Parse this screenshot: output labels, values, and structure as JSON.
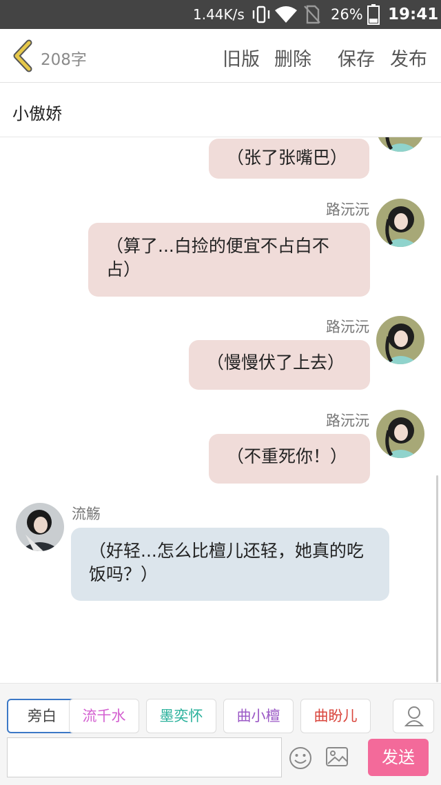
{
  "status_bar": {
    "net_speed": "1.44K/s",
    "battery_pct": "26%",
    "time": "19:41",
    "icons": [
      "vibrate-icon",
      "wifi-icon",
      "no-sim-icon",
      "battery-icon"
    ]
  },
  "toolbar": {
    "back_icon": "chevron-left-icon",
    "word_count": "208字",
    "old_version": "旧版",
    "delete": "删除",
    "save": "保存",
    "publish": "发布"
  },
  "title": "小傲娇",
  "messages": [
    {
      "side": "right",
      "sender": "",
      "text": "（张了张嘴巴）"
    },
    {
      "side": "right",
      "sender": "路沅沅",
      "text": "（算了...白捡的便宜不占白不占）"
    },
    {
      "side": "right",
      "sender": "路沅沅",
      "text": "（慢慢伏了上去）"
    },
    {
      "side": "right",
      "sender": "路沅沅",
      "text": "（不重死你！）"
    },
    {
      "side": "left",
      "sender": "流觞",
      "text": "（好轻...怎么比檀儿还轻，她真的吃饭吗？）"
    }
  ],
  "roles": [
    {
      "label": "旁白",
      "color": "#444444",
      "active": true
    },
    {
      "label": "流千水",
      "color": "#d35fd0",
      "active": false
    },
    {
      "label": "墨奕怀",
      "color": "#27b09a",
      "active": false
    },
    {
      "label": "曲小檀",
      "color": "#9b59c6",
      "active": false
    },
    {
      "label": "曲盼儿",
      "color": "#d9443b",
      "active": false
    }
  ],
  "composer": {
    "placeholder": "",
    "send": "发送",
    "icons": [
      "emoji-icon",
      "image-icon",
      "person-icon"
    ]
  },
  "colors": {
    "status_bar_bg": "#444444",
    "right_bubble": "#f0dcd9",
    "left_bubble": "#dce5ec",
    "send_button": "#f36a9a",
    "back_chevron": "#e6c84a"
  }
}
